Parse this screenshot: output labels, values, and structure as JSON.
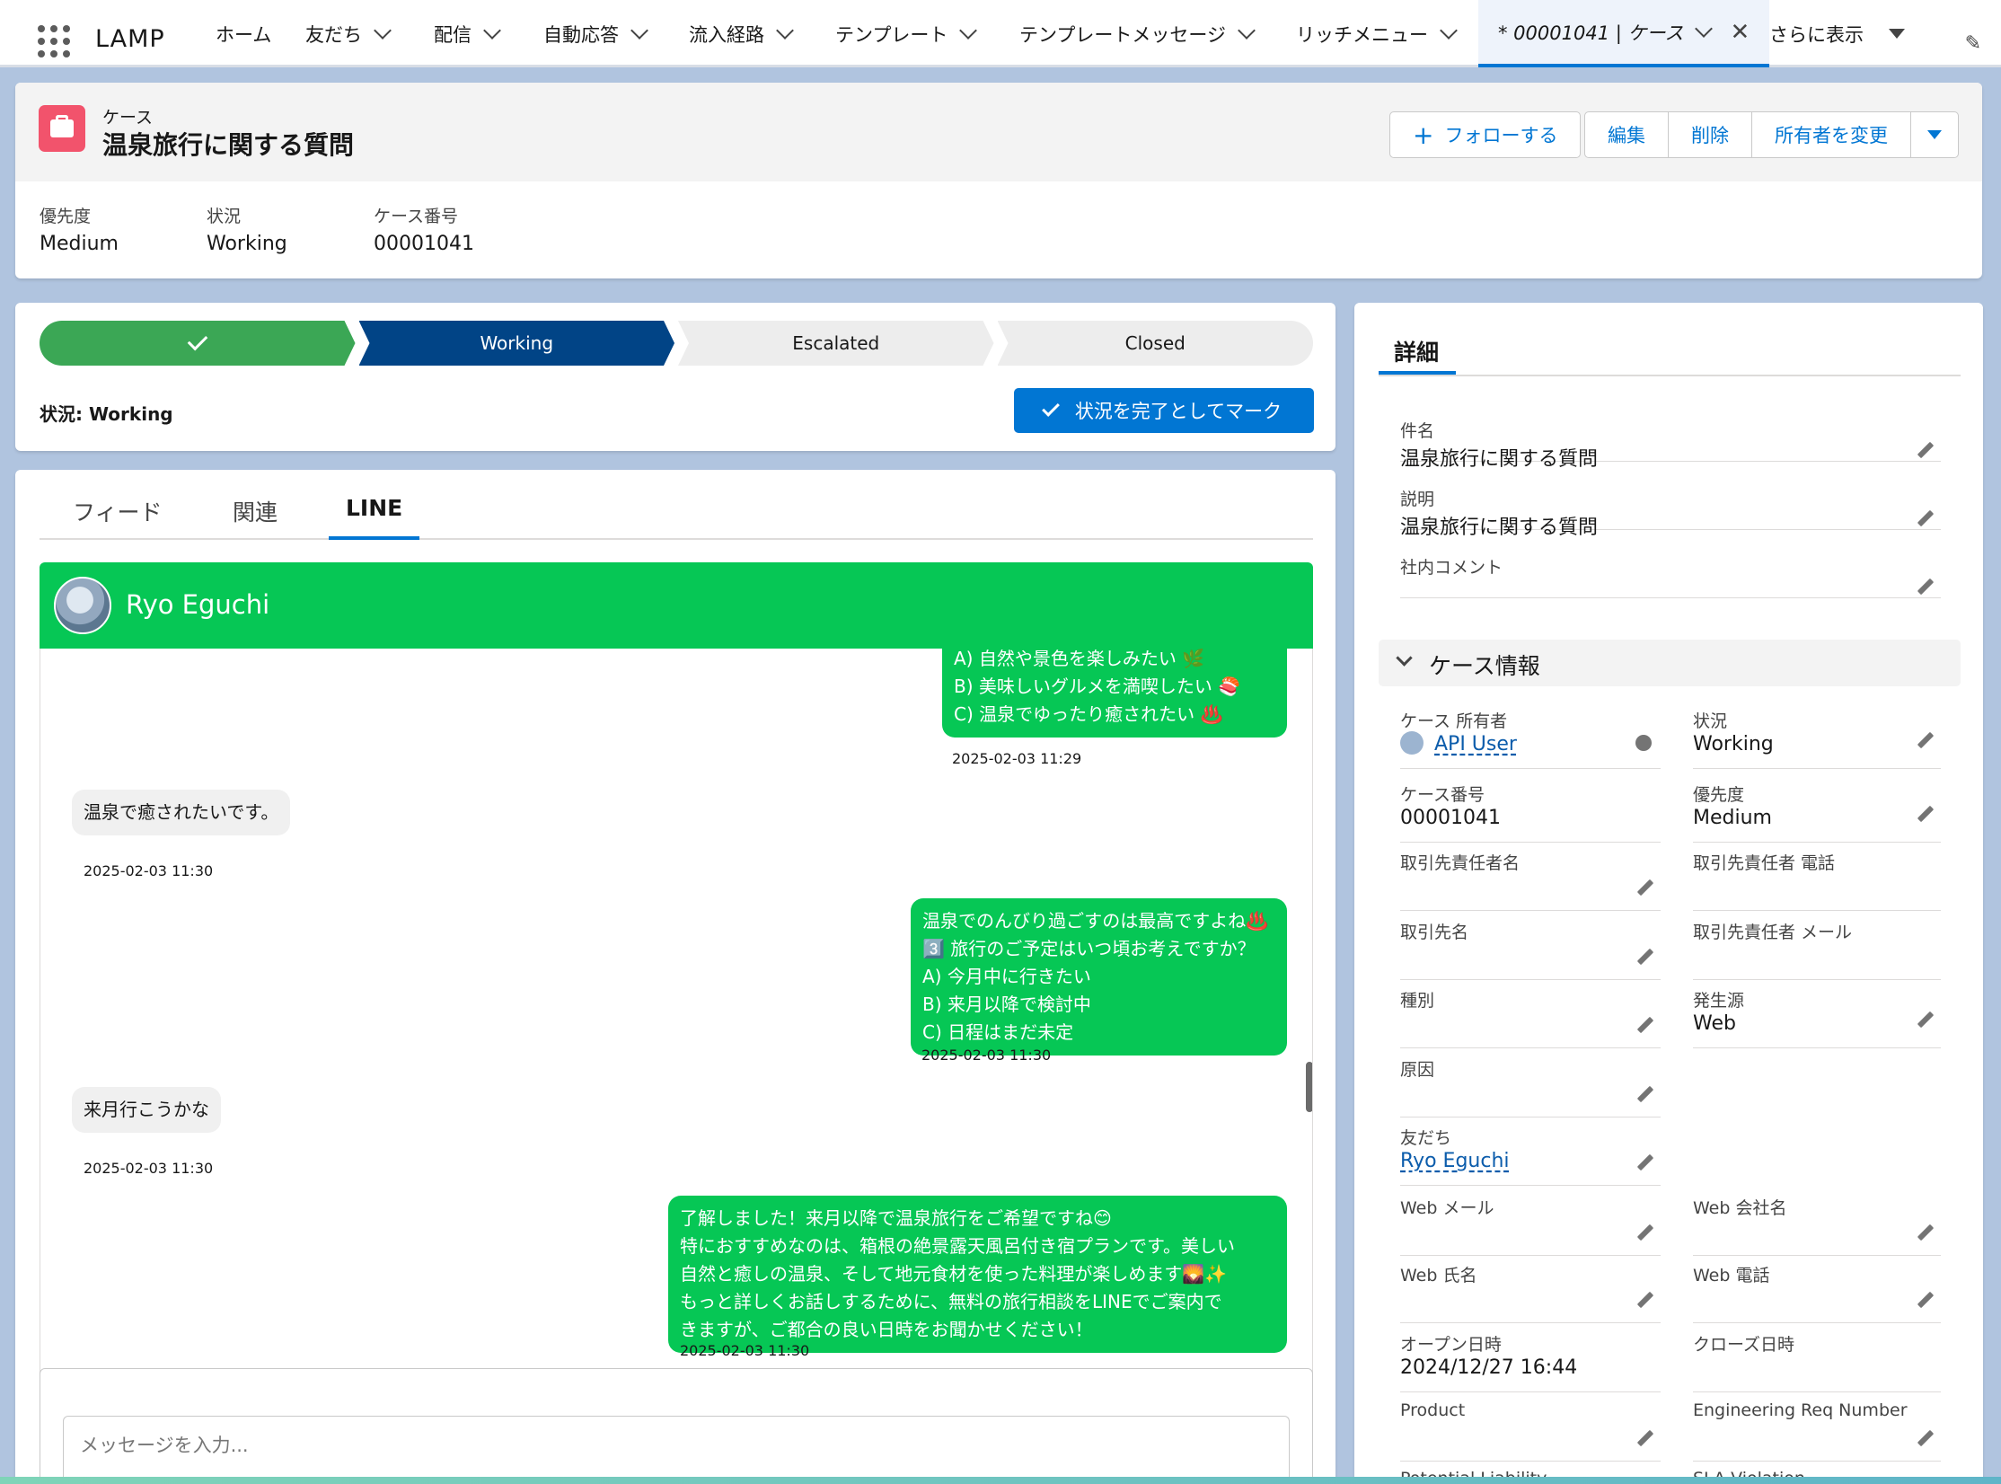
{
  "app": {
    "name": "LAMP"
  },
  "nav": {
    "items": [
      {
        "label": "ホーム",
        "has_menu": false
      },
      {
        "label": "友だち",
        "has_menu": true
      },
      {
        "label": "配信",
        "has_menu": true
      },
      {
        "label": "自動応答",
        "has_menu": true
      },
      {
        "label": "流入経路",
        "has_menu": true
      },
      {
        "label": "テンプレート",
        "has_menu": true
      },
      {
        "label": "テンプレートメッセージ",
        "has_menu": true
      },
      {
        "label": "リッチメニュー",
        "has_menu": true
      }
    ],
    "active_tab": "* 00001041 | ケース",
    "more": "さらに表示"
  },
  "header": {
    "object_label": "ケース",
    "title": "温泉旅行に関する質問",
    "follow_label": "フォローする",
    "actions": [
      "編集",
      "削除",
      "所有者を変更"
    ],
    "highlights": [
      {
        "label": "優先度",
        "value": "Medium"
      },
      {
        "label": "状況",
        "value": "Working"
      },
      {
        "label": "ケース番号",
        "value": "00001041"
      }
    ]
  },
  "path": {
    "stages": [
      {
        "label": "",
        "state": "done"
      },
      {
        "label": "Working",
        "state": "current"
      },
      {
        "label": "Escalated",
        "state": "todo"
      },
      {
        "label": "Closed",
        "state": "todo"
      }
    ],
    "status_text": "状況: Working",
    "mark_complete": "状況を完了としてマーク"
  },
  "tabs": [
    "フィード",
    "関連",
    "LINE"
  ],
  "chat": {
    "contact_name": "Ryo Eguchi",
    "messages": [
      {
        "dir": "out",
        "text": "A) 自然や景色を楽しみたい 🌿\nB) 美味しいグルメを満喫したい 🍣\nC) 温泉でゆったり癒されたい ♨️",
        "time": "2025-02-03 11:29"
      },
      {
        "dir": "in",
        "text": "温泉で癒されたいです。",
        "time": "2025-02-03 11:30"
      },
      {
        "dir": "out",
        "text": "温泉でのんびり過ごすのは最高ですよね♨️\n3️⃣ 旅行のご予定はいつ頃お考えですか？\nA) 今月中に行きたい\nB) 来月以降で検討中\nC) 日程はまだ未定",
        "time": "2025-02-03 11:30"
      },
      {
        "dir": "in",
        "text": "来月行こうかな",
        "time": "2025-02-03 11:30"
      },
      {
        "dir": "out",
        "text": "了解しました！来月以降で温泉旅行をご希望ですね😊\n特におすすめなのは、箱根の絶景露天風呂付き宿プランです。美しい\n自然と癒しの温泉、そして地元食材を使った料理が楽しめます🌄✨\nもっと詳しくお話しするために、無料の旅行相談をLINEでご案内で\nきますが、ご都合の良い日時をお聞かせください！",
        "time": "2025-02-03 11:30"
      }
    ],
    "input_placeholder": "メッセージを入力..."
  },
  "detail": {
    "tab": "詳細",
    "top_fields": [
      {
        "label": "件名",
        "value": "温泉旅行に関する質問"
      },
      {
        "label": "説明",
        "value": "温泉旅行に関する質問"
      },
      {
        "label": "社内コメント",
        "value": ""
      }
    ],
    "section_title": "ケース情報",
    "left_fields": [
      {
        "label": "ケース 所有者",
        "value": "API User"
      },
      {
        "label": "ケース番号",
        "value": "00001041"
      },
      {
        "label": "取引先責任者名",
        "value": ""
      },
      {
        "label": "取引先名",
        "value": ""
      },
      {
        "label": "種別",
        "value": ""
      },
      {
        "label": "原因",
        "value": ""
      },
      {
        "label": "友だち",
        "value": "Ryo Eguchi"
      },
      {
        "label": "Web メール",
        "value": ""
      },
      {
        "label": "Web 氏名",
        "value": ""
      },
      {
        "label": "オープン日時",
        "value": "2024/12/27 16:44"
      },
      {
        "label": "Product",
        "value": ""
      },
      {
        "label": "Potential Liability",
        "value": ""
      }
    ],
    "right_fields": [
      {
        "label": "状況",
        "value": "Working"
      },
      {
        "label": "優先度",
        "value": "Medium"
      },
      {
        "label": "取引先責任者 電話",
        "value": ""
      },
      {
        "label": "取引先責任者 メール",
        "value": ""
      },
      {
        "label": "発生源",
        "value": "Web"
      },
      {
        "label": "Web 会社名",
        "value": ""
      },
      {
        "label": "Web 電話",
        "value": ""
      },
      {
        "label": "クローズ日時",
        "value": ""
      },
      {
        "label": "Engineering Req Number",
        "value": ""
      },
      {
        "label": "SLA Violation",
        "value": ""
      }
    ]
  },
  "colors": {
    "brand_blue": "#0176d3",
    "line_green": "#06c755",
    "path_done": "#3ba755",
    "path_current": "#014486",
    "case_icon": "#f2536c"
  }
}
